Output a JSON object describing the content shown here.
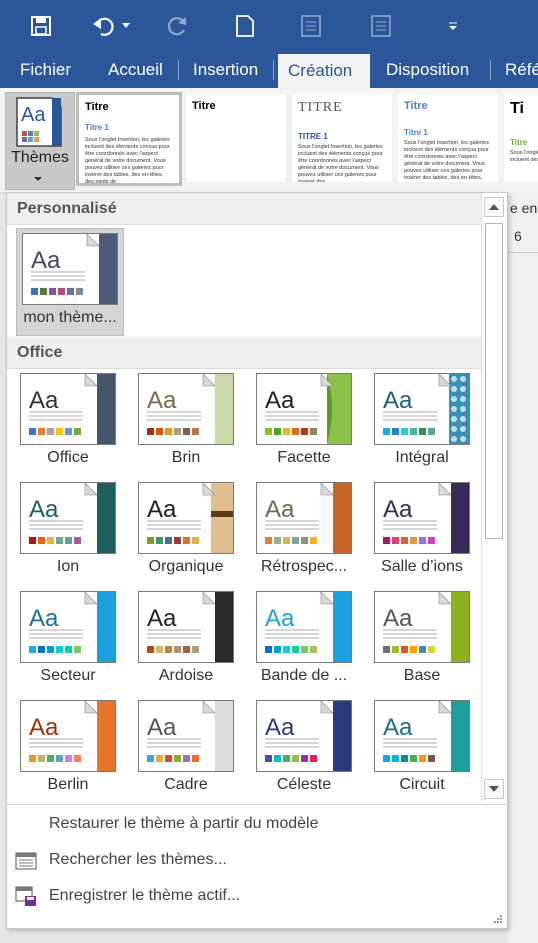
{
  "ribbon_tabs": [
    "Fichier",
    "Accueil",
    "Insertion",
    "Création",
    "Disposition",
    "Réfé"
  ],
  "themes_button": {
    "label": "Thèmes"
  },
  "style_gallery": [
    {
      "title": "Titre",
      "heading": "Titre 1",
      "body": "Sous l'onglet Insertion, les galeries incluent des éléments conçus pour être coordonnés avec l'aspect général de votre document. Vous pouvez utiliser ces galeries pour insérer des tables, des en-têtes, des pieds de"
    },
    {
      "title": "Titre",
      "heading": "",
      "body": ""
    },
    {
      "title": "TITRE",
      "heading": "TITRE 1",
      "body": "Sous l'onglet Insertion, les galeries incluent des éléments conçus pour être coordonnés avec l'aspect général de votre document. Vous pouvez utiliser ces galeries pour insérer des"
    },
    {
      "title": "Titre",
      "heading": "Titre 1",
      "body": "Sous l'onglet Insertion, les galeries incluent des éléments conçus pour être coordonnés avec l'aspect général de votre document. Vous pouvez utiliser ces galeries pour insérer des tables, des en-têtes, des pieds de page, des listes, des"
    },
    {
      "title": "Ti",
      "heading": "Titre",
      "body": "Sous l'onglet Insertion, les galeries incluent des éléments coordonnés"
    }
  ],
  "right_partial": {
    "text1": "e en f",
    "text2": "6"
  },
  "sections": {
    "custom": "Personnalisé",
    "office": "Office"
  },
  "custom_theme": {
    "label": "mon thème...",
    "font_color": "#3d4a63",
    "strip": "#4a5a78",
    "swatches": [
      "#3d6fb0",
      "#5b7a3d",
      "#8a4f9e",
      "#b5497a",
      "#6b6b9e",
      "#7a8c9e"
    ]
  },
  "themes": [
    {
      "label": "Office",
      "font_color": "#333333",
      "bar": "#44546a",
      "deco": "strip",
      "swatches": [
        "#4472c4",
        "#ed7d31",
        "#a5a5a5",
        "#ffc000",
        "#5b9bd5",
        "#70ad47"
      ]
    },
    {
      "label": "Brin",
      "font_color": "#7a6a4f",
      "bar": "#c9d9a8",
      "deco": "strip",
      "swatches": [
        "#a5300f",
        "#d55816",
        "#e19825",
        "#b19c7d",
        "#7f5f52",
        "#b27d49"
      ]
    },
    {
      "label": "Facette",
      "font_color": "#222222",
      "bar": "#5b9a2a",
      "deco": "green",
      "swatches": [
        "#90c226",
        "#54a021",
        "#e6b91e",
        "#e76618",
        "#c42f1a",
        "#918655"
      ]
    },
    {
      "label": "Intégral",
      "font_color": "#1e5e7a",
      "bar": "#3a8fb7",
      "deco": "pattern",
      "swatches": [
        "#1cade4",
        "#2683c6",
        "#27ced7",
        "#42ba97",
        "#3e8853",
        "#62a39f"
      ]
    },
    {
      "label": "Ion",
      "font_color": "#1e5e5e",
      "bar": "#1e5e5e",
      "deco": "strip",
      "swatches": [
        "#b01513",
        "#ea6312",
        "#e6b729",
        "#6aac90",
        "#5f9c9d",
        "#9e5e9b"
      ]
    },
    {
      "label": "Organique",
      "font_color": "#222222",
      "bar": "#e0c090",
      "deco": "wood",
      "swatches": [
        "#83992a",
        "#3c9770",
        "#44709d",
        "#a23c33",
        "#d97828",
        "#deb340"
      ]
    },
    {
      "label": "Rétrospec...",
      "font_color": "#6b6b4f",
      "bar": "#c86428",
      "deco": "strip",
      "swatches": [
        "#dd8047",
        "#a5ab81",
        "#d8b25c",
        "#7ba79d",
        "#968c8c",
        "#f7b615"
      ]
    },
    {
      "label": "Salle d’ions",
      "font_color": "#3a2a5a",
      "bar": "#3a2a5a",
      "deco": "strip",
      "swatches": [
        "#b31166",
        "#e33d6f",
        "#e45f3c",
        "#e9943a",
        "#9b6bf2",
        "#d53dd0"
      ]
    },
    {
      "label": "Secteur",
      "font_color": "#1e6e9e",
      "bar": "#1ba1e2",
      "deco": "strip",
      "swatches": [
        "#1cade4",
        "#0f6fc6",
        "#009dd9",
        "#0bd0d9",
        "#10cf9b",
        "#7cca62"
      ]
    },
    {
      "label": "Ardoise",
      "font_color": "#222222",
      "bar": "#2a2a2a",
      "deco": "strip",
      "swatches": [
        "#bc451b",
        "#d3ba68",
        "#bb8640",
        "#ad9277",
        "#a55a43",
        "#ad9d7b"
      ]
    },
    {
      "label": "Bande de ...",
      "font_color": "#1ba1e2",
      "bar": "#1ba1e2",
      "deco": "strip",
      "swatches": [
        "#0f6fc6",
        "#009dd9",
        "#0bd0d9",
        "#10cf9b",
        "#7cca62",
        "#a5c249"
      ]
    },
    {
      "label": "Base",
      "font_color": "#555555",
      "bar": "#8ab31e",
      "deco": "strip",
      "swatches": [
        "#6f6f74",
        "#a6b727",
        "#df5327",
        "#fe9e00",
        "#418ab3",
        "#d7d447"
      ]
    },
    {
      "label": "Berlin",
      "font_color": "#a0300a",
      "bar": "#e8732a",
      "deco": "strip",
      "swatches": [
        "#f09415",
        "#c1b56b",
        "#4baf73",
        "#5aa6c0",
        "#d17df9",
        "#fa7e5c"
      ]
    },
    {
      "label": "Cadre",
      "font_color": "#555555",
      "bar": "#dcdcdc",
      "deco": "strip",
      "swatches": [
        "#40a5e0",
        "#f0ab32",
        "#d64a3b",
        "#8ab31e",
        "#9e6bbd",
        "#ed6a2a"
      ]
    },
    {
      "label": "Céleste",
      "font_color": "#2a3a7a",
      "bar": "#2a3a7a",
      "deco": "strip",
      "swatches": [
        "#3f51b5",
        "#00bcd4",
        "#4caf50",
        "#8bc34a",
        "#9c27b0",
        "#e91e63"
      ]
    },
    {
      "label": "Circuit",
      "font_color": "#1e6e8e",
      "bar": "#1a9e9e",
      "deco": "strip",
      "swatches": [
        "#03a9f4",
        "#00bcd4",
        "#009688",
        "#4caf50",
        "#ff9800",
        "#795548"
      ]
    }
  ],
  "menu": {
    "restore": "Restaurer le thème à partir du modèle",
    "browse": "Rechercher les thèmes...",
    "save": "Enregistrer le thème actif..."
  }
}
